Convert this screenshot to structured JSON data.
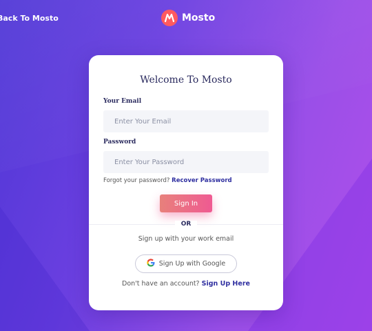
{
  "header": {
    "back_link": "Back To Mosto",
    "brand_name": "Mosto",
    "brand_icon": "mosto-logo-icon"
  },
  "card": {
    "title": "Welcome To Mosto",
    "email": {
      "label": "Your Email",
      "placeholder": "Enter Your Email",
      "value": ""
    },
    "password": {
      "label": "Password",
      "placeholder": "Enter Your Password",
      "value": ""
    },
    "forgot_text": "Forgot your password?",
    "forgot_link": "Recover Password",
    "signin_label": "Sign In",
    "or_text": "OR",
    "work_email_text": "Sign up with your work email",
    "google_label": "Sign Up with Google",
    "google_icon": "google-g-icon",
    "no_account_text": "Don't have an account?",
    "signup_link": "Sign Up Here"
  },
  "colors": {
    "accent": "#2f2fa0",
    "button_start": "#e8807b",
    "button_end": "#ef5a92",
    "logo": "#ff5a5f"
  }
}
